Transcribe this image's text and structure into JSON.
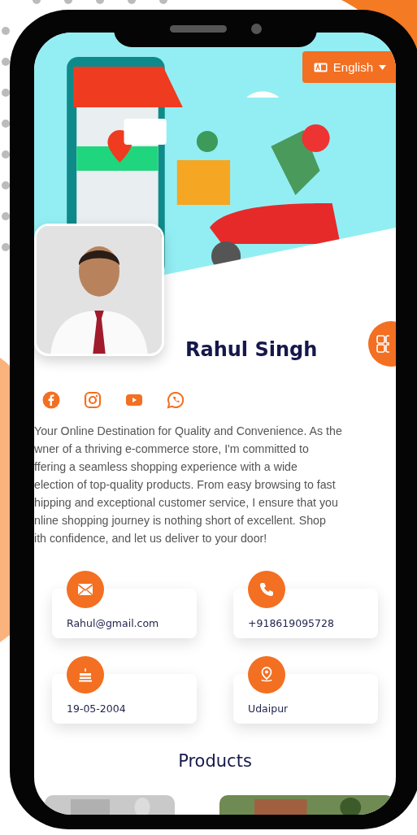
{
  "language_button": {
    "label": "English"
  },
  "profile": {
    "name": "Rahul Singh"
  },
  "social_links": [
    {
      "kind": "facebook"
    },
    {
      "kind": "instagram"
    },
    {
      "kind": "youtube"
    },
    {
      "kind": "whatsapp"
    }
  ],
  "bio_lines": [
    "Your Online Destination for Quality and Convenience. As the",
    "wner of a thriving e-commerce store, I'm committed to",
    "ffering a seamless shopping experience with a wide",
    "election of top-quality products. From easy browsing to fast",
    "hipping and exceptional customer service, I ensure that you",
    "nline shopping journey is nothing short of excellent. Shop",
    "ith confidence, and let us deliver to your door!"
  ],
  "contacts": [
    {
      "kind": "email",
      "value": "Rahul@gmail.com"
    },
    {
      "kind": "phone",
      "value": "+918619095728"
    },
    {
      "kind": "birthday",
      "value": "19-05-2004"
    },
    {
      "kind": "location",
      "value": "Udaipur"
    }
  ],
  "products": {
    "title": "Products"
  }
}
